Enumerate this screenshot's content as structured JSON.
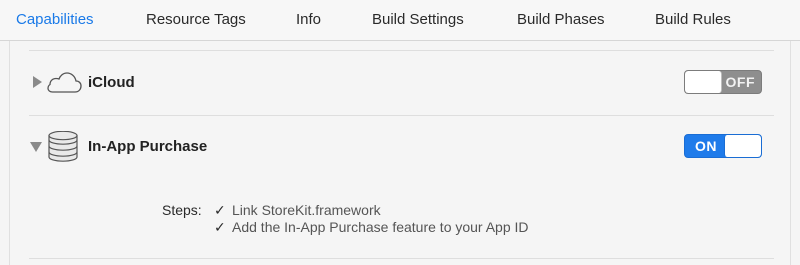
{
  "tabs": [
    {
      "label": "Capabilities",
      "active": true
    },
    {
      "label": "Resource Tags",
      "active": false
    },
    {
      "label": "Info",
      "active": false
    },
    {
      "label": "Build Settings",
      "active": false
    },
    {
      "label": "Build Phases",
      "active": false
    },
    {
      "label": "Build Rules",
      "active": false
    }
  ],
  "capabilities": [
    {
      "title": "iCloud",
      "icon": "cloud-icon",
      "expanded": false,
      "toggle": {
        "state": "off",
        "label": "OFF"
      }
    },
    {
      "title": "In-App Purchase",
      "icon": "coins-stack-icon",
      "expanded": true,
      "toggle": {
        "state": "on",
        "label": "ON"
      },
      "steps_label": "Steps:",
      "steps": [
        {
          "check": "✓",
          "text": "Link StoreKit.framework"
        },
        {
          "check": "✓",
          "text": "Add the In-App Purchase feature to your App ID"
        }
      ]
    }
  ],
  "colors": {
    "accent": "#1a7ae8",
    "toggle_on": "#1f7bea",
    "toggle_off": "#8e8e8e"
  }
}
